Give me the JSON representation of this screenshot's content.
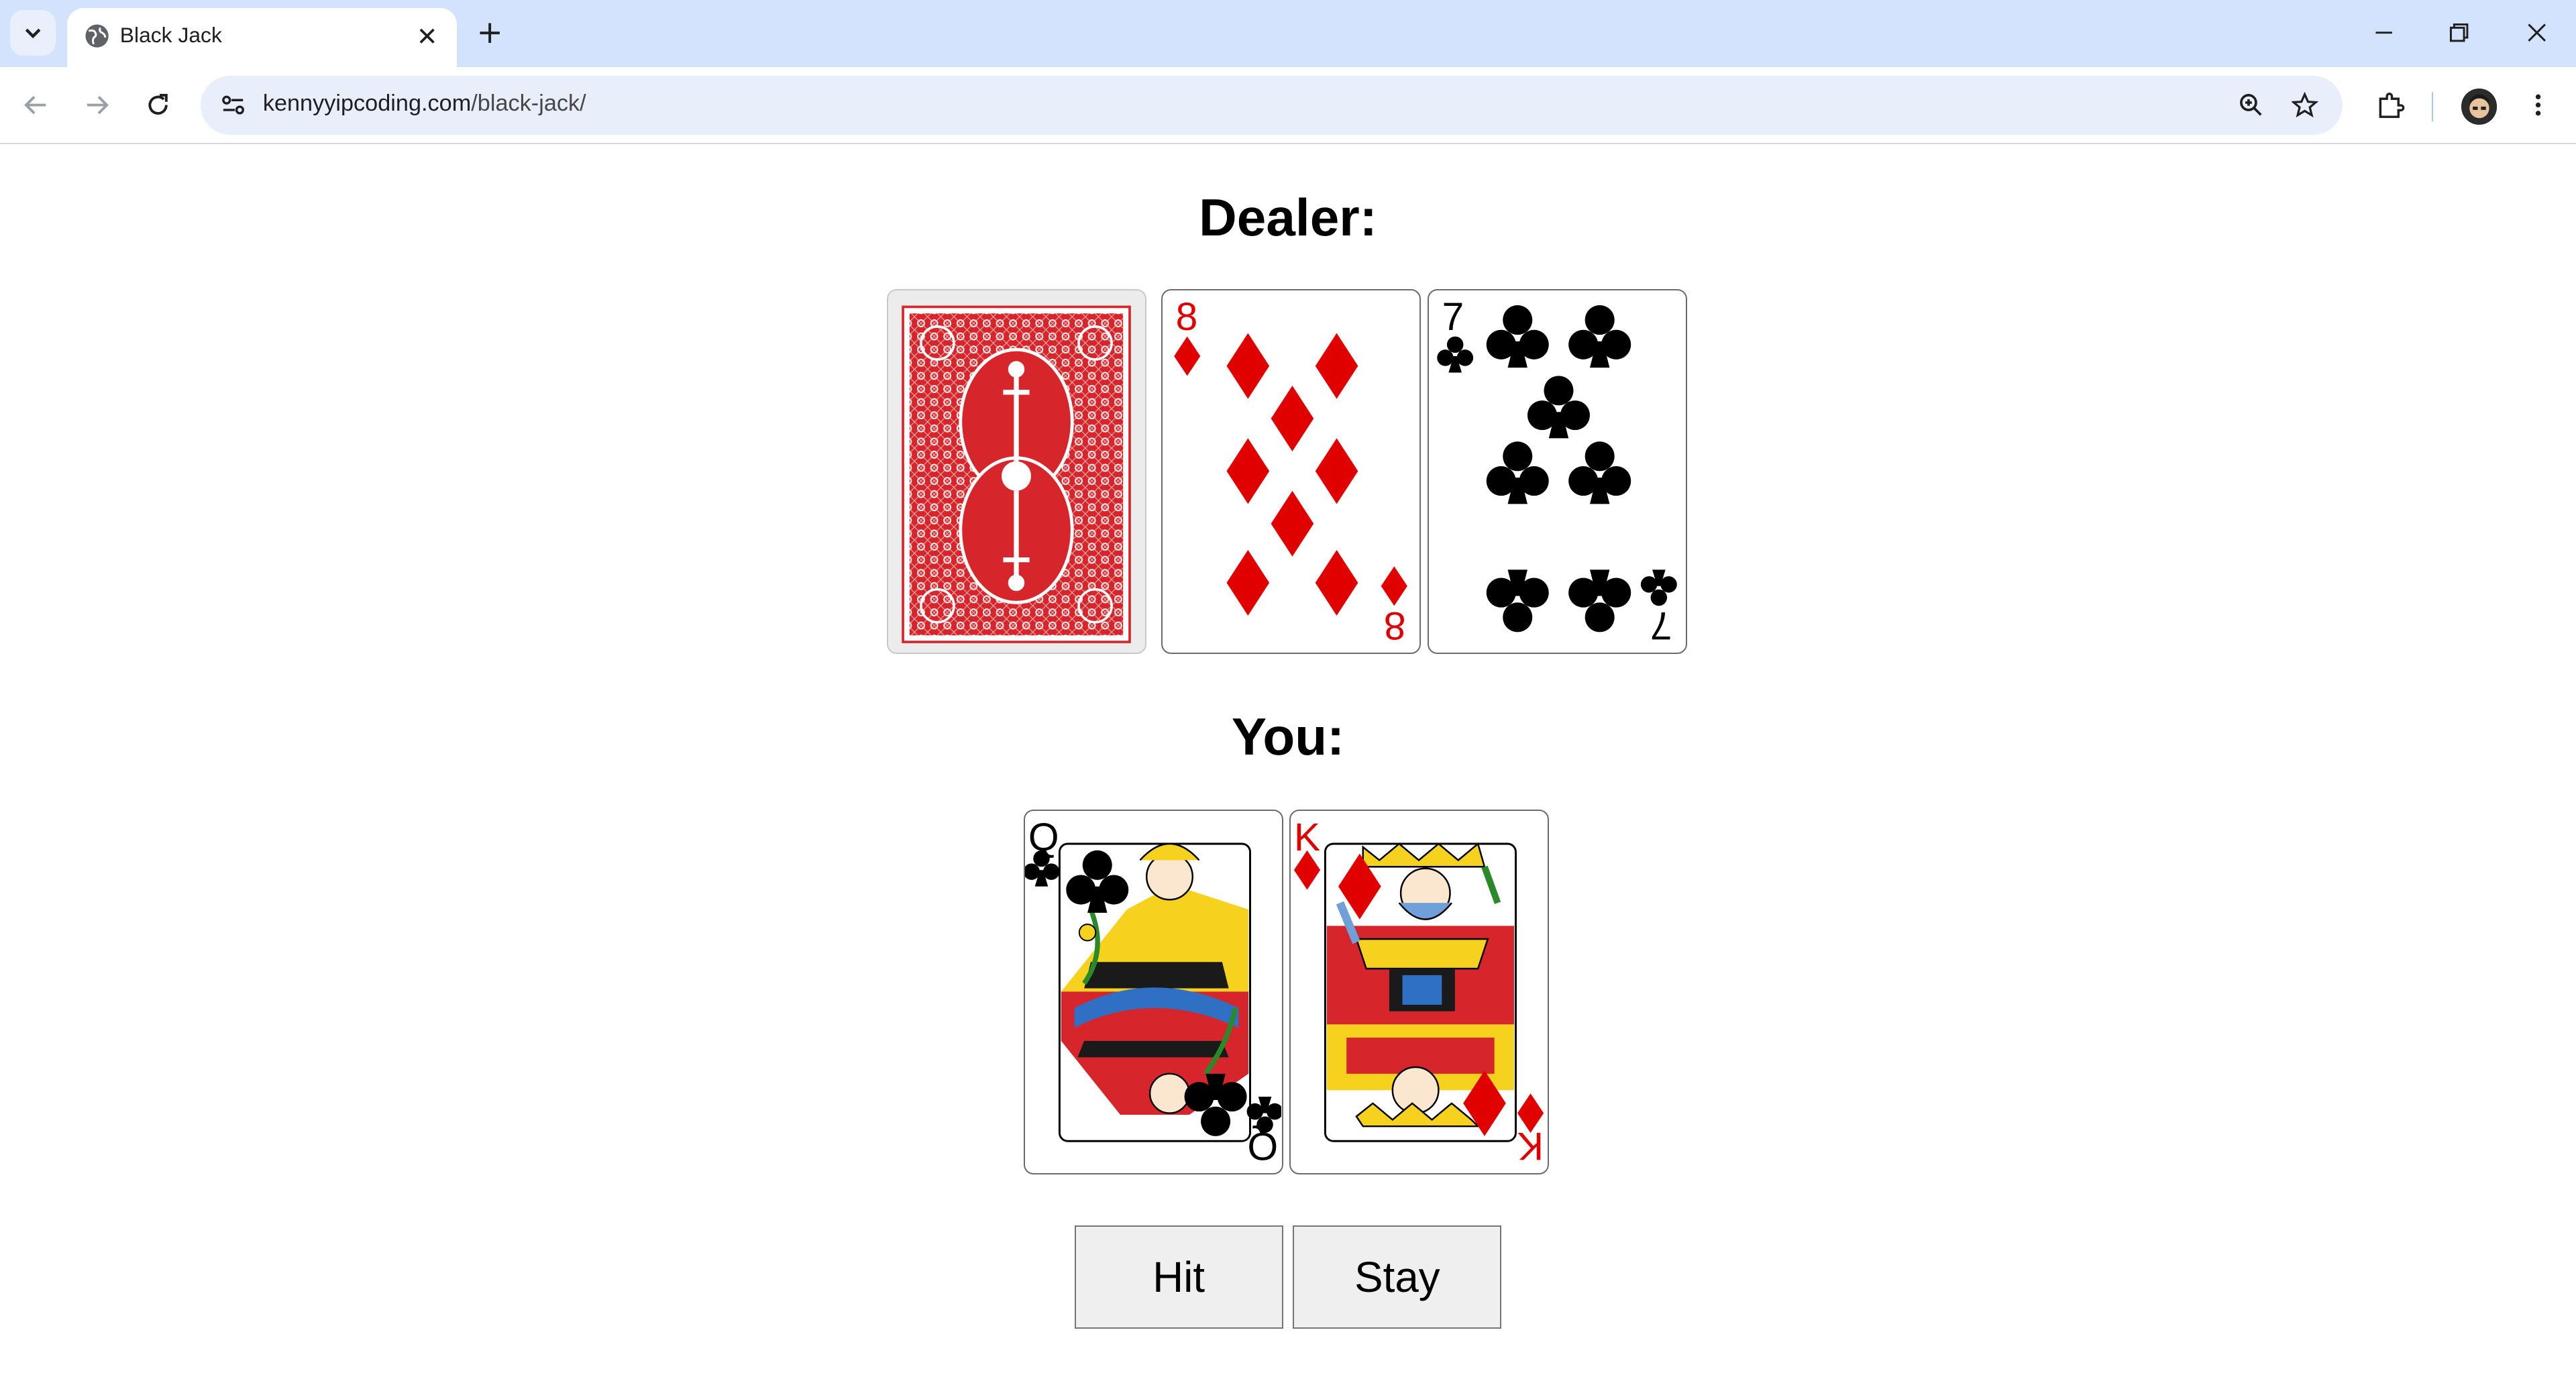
{
  "browser": {
    "tab_title": "Black Jack",
    "url_host": "kennyyipcoding.com",
    "url_path": "/black-jack/",
    "icons": [
      "tab-search-icon",
      "globe-icon",
      "close-icon",
      "plus-icon",
      "minimize-icon",
      "restore-icon",
      "window-close-icon",
      "back-icon",
      "forward-icon",
      "reload-icon",
      "site-info-icon",
      "zoom-icon",
      "star-icon",
      "extensions-icon",
      "avatar",
      "more-icon"
    ]
  },
  "game": {
    "dealer_label": "Dealer:",
    "player_label": "You:",
    "dealer_cards": [
      {
        "rank": "",
        "suit": "hidden",
        "face_down": true
      },
      {
        "rank": "8",
        "suit": "diamonds",
        "color": "#e00000"
      },
      {
        "rank": "7",
        "suit": "clubs",
        "color": "#000000"
      }
    ],
    "player_cards": [
      {
        "rank": "Q",
        "suit": "clubs",
        "color": "#000000"
      },
      {
        "rank": "K",
        "suit": "diamonds",
        "color": "#e00000"
      }
    ],
    "hit_label": "Hit",
    "stay_label": "Stay"
  },
  "colors": {
    "red_suit": "#e00000",
    "card_back": "#d7262b",
    "tabstrip": "#d3e3fd"
  }
}
